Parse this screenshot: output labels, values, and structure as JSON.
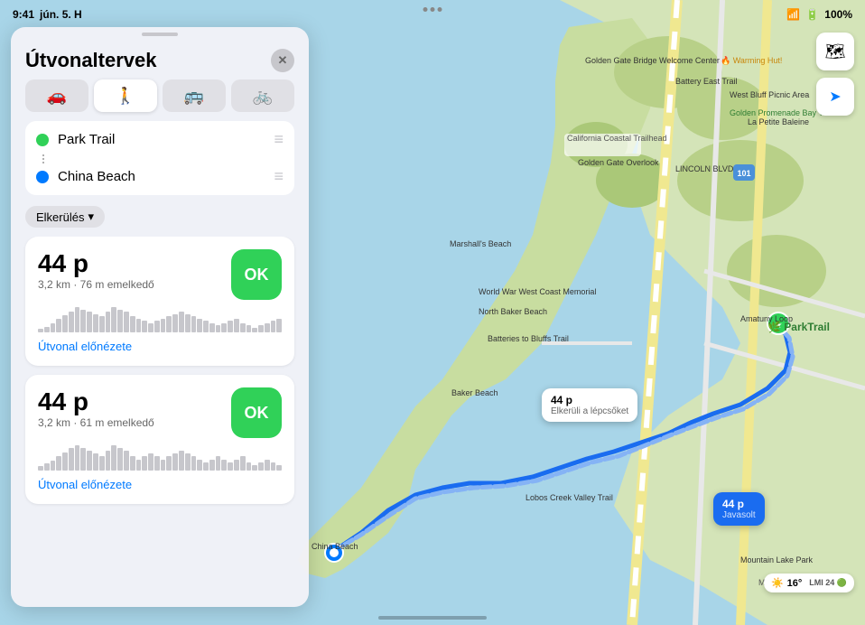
{
  "statusBar": {
    "time": "9:41",
    "date": "jún. 5. H",
    "wifi": "WiFi",
    "battery": "100%"
  },
  "sidebar": {
    "title": "Útvonaltervek",
    "closeLabel": "✕",
    "transportTabs": [
      {
        "id": "car",
        "icon": "🚗",
        "active": false
      },
      {
        "id": "walk",
        "icon": "🚶",
        "active": true
      },
      {
        "id": "transit",
        "icon": "🚌",
        "active": false
      },
      {
        "id": "bike",
        "icon": "🚲",
        "active": false
      }
    ],
    "waypoints": [
      {
        "id": "origin",
        "name": "Park Trail",
        "dotClass": "green"
      },
      {
        "id": "destination",
        "name": "China Beach",
        "dotClass": "blue"
      }
    ],
    "avoidanceLabel": "Elkerülés",
    "routes": [
      {
        "id": "route1",
        "time": "44 p",
        "details": "3,2 km · 76 m emelkedő",
        "okLabel": "OK",
        "previewLabel": "Útvonal előnézete",
        "elevationBars": [
          3,
          5,
          8,
          12,
          15,
          18,
          22,
          20,
          18,
          16,
          14,
          18,
          22,
          20,
          18,
          14,
          12,
          10,
          8,
          10,
          12,
          14,
          16,
          18,
          16,
          14,
          12,
          10,
          8,
          6,
          8,
          10,
          12,
          8,
          6,
          4,
          6,
          8,
          10,
          12
        ]
      },
      {
        "id": "route2",
        "time": "44 p",
        "details": "3,2 km · 61 m emelkedő",
        "okLabel": "OK",
        "previewLabel": "Útvonal előnézete",
        "elevationBars": [
          3,
          5,
          7,
          10,
          13,
          16,
          18,
          16,
          14,
          12,
          10,
          14,
          18,
          16,
          14,
          10,
          8,
          10,
          12,
          10,
          8,
          10,
          12,
          14,
          12,
          10,
          8,
          6,
          8,
          10,
          8,
          6,
          8,
          10,
          6,
          4,
          6,
          8,
          6,
          4
        ]
      }
    ]
  },
  "map": {
    "callouts": [
      {
        "id": "route1",
        "time": "44 p",
        "sub": "Elkerüli a lépcsőket",
        "suggested": false,
        "top": "440",
        "left": "610"
      },
      {
        "id": "route2",
        "time": "44 p",
        "sub": "Javasolt",
        "suggested": true,
        "top": "548",
        "left": "800"
      }
    ],
    "weatherTemp": "16°",
    "weatherIcon": "☀️",
    "weatherExtra": "LMI 24 ●",
    "labels": [
      {
        "text": "Golden Gate Bridge Welcome Center",
        "top": "68",
        "left": "670"
      },
      {
        "text": "Warming Hut!",
        "top": "68",
        "left": "790"
      },
      {
        "text": "Battery East Trail",
        "top": "90",
        "left": "750"
      },
      {
        "text": "West Bluff Picnic Area",
        "top": "105",
        "left": "810"
      },
      {
        "text": "Golden Gate Overlook",
        "top": "185",
        "left": "640"
      },
      {
        "text": "Marshall's Beach",
        "top": "270",
        "left": "505"
      },
      {
        "text": "World War West Coast Memorial",
        "top": "330",
        "left": "570"
      },
      {
        "text": "Batteries to Bluffs Trail",
        "top": "380",
        "left": "558"
      },
      {
        "text": "Baker Beach",
        "top": "440",
        "left": "508"
      },
      {
        "text": "North Baker Beach",
        "top": "305",
        "left": "535"
      },
      {
        "text": "Amatuny Loop",
        "top": "355",
        "left": "820"
      },
      {
        "text": "Park Trail",
        "top": "360",
        "left": "858"
      },
      {
        "text": "China Beach",
        "top": "608",
        "left": "352"
      },
      {
        "text": "Lobos Creek Valley Trail",
        "top": "548",
        "left": "590"
      },
      {
        "text": "Mountain Lake Park",
        "top": "620",
        "left": "830"
      },
      {
        "text": "101",
        "top": "185",
        "left": "818"
      }
    ]
  },
  "icons": {
    "map": "🗺",
    "location": "➤",
    "chevronDown": "▾"
  }
}
